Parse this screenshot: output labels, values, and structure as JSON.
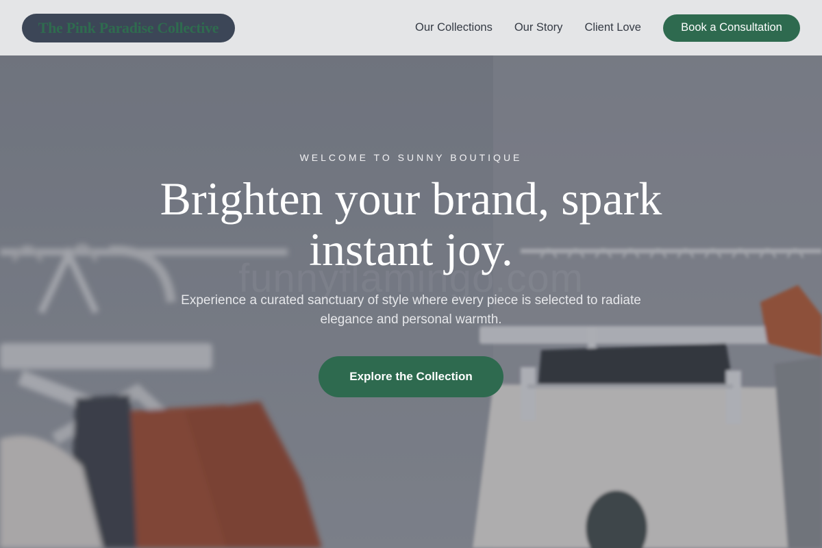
{
  "header": {
    "brand": "The Pink Paradise Collective",
    "nav": [
      "Our Collections",
      "Our Story",
      "Client Love"
    ],
    "cta": "Book a Consultation"
  },
  "hero": {
    "eyebrow": "WELCOME TO SUNNY BOUTIQUE",
    "headline": "Brighten your brand, spark instant joy.",
    "subhead": "Experience a curated sanctuary of style where every piece is selected to radiate elegance and personal warmth.",
    "cta": "Explore the Collection",
    "watermark": "funnyflamingo.com"
  },
  "colors": {
    "accent": "#2e6a4f",
    "header_bg": "#e4e5e7",
    "brand_pill": "#3c4657"
  }
}
